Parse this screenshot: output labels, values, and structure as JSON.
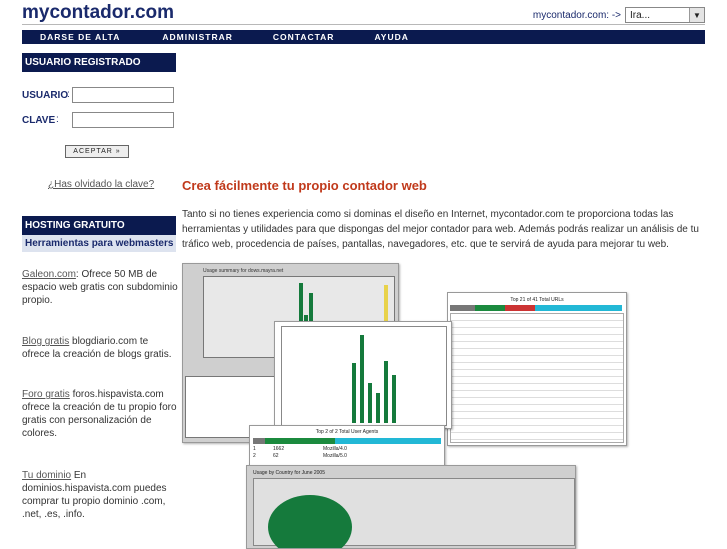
{
  "header": {
    "logo": "mycontador.com",
    "jump_label": "mycontador.com: ->",
    "jump_select": "Ira..."
  },
  "nav": [
    "DARSE DE ALTA",
    "ADMINISTRAR",
    "CONTACTAR",
    "AYUDA"
  ],
  "login": {
    "title": "USUARIO REGISTRADO",
    "user_label": "USUARIO",
    "pass_label": "CLAVE",
    "button": "ACEPTAR »",
    "forgot": "¿Has olvidado la clave?"
  },
  "hosting": {
    "title": "HOSTING GRATUITO",
    "subtitle": "Herramientas para webmasters",
    "items": [
      {
        "link": "Galeon.com",
        "text": ": Ofrece 50 MB de espacio web gratis con subdominio propio."
      },
      {
        "link": "Blog gratis",
        "text": " blogdiario.com te ofrece la creación de blogs gratis."
      },
      {
        "link": "Foro gratis",
        "text": " foros.hispavista.com ofrece la creación de tu propio foro gratis con personalización de colores."
      },
      {
        "link": "Tu dominio",
        "text": " En dominios.hispavista.com puedes comprar tu propio dominio .com, .net, .es, .info."
      }
    ]
  },
  "main": {
    "headline": "Crea fácilmente tu propio contador web",
    "intro": "Tanto si no tienes experiencia como si dominas el diseño en Internet, mycontador.com te proporciona todas las herramientas y utilidades para que dispongas del mejor contador para web. Además podrás realizar un análisis de tu tráfico web, procedencia de países, pantallas, navegadores, etc. que te servirá de ayuda para mejorar tu web."
  },
  "screens": {
    "summary_title": "Usage summary for dows.mayra.net",
    "urls_title": "Top 21 of 41 Total URLs",
    "agents_title": "Top 2 of 2 Total User Agents",
    "country_title": "Usage by Country for June 2005",
    "agents_rows": [
      [
        "1",
        "1662",
        "Mozilla/4.0"
      ],
      [
        "2",
        "62",
        "Mozilla/5.0"
      ]
    ]
  },
  "colors": {
    "navy": "#0b1a4f",
    "headline": "#c0391b",
    "chart_green": "#157a3c",
    "chart_yellow": "#e8d24a"
  }
}
